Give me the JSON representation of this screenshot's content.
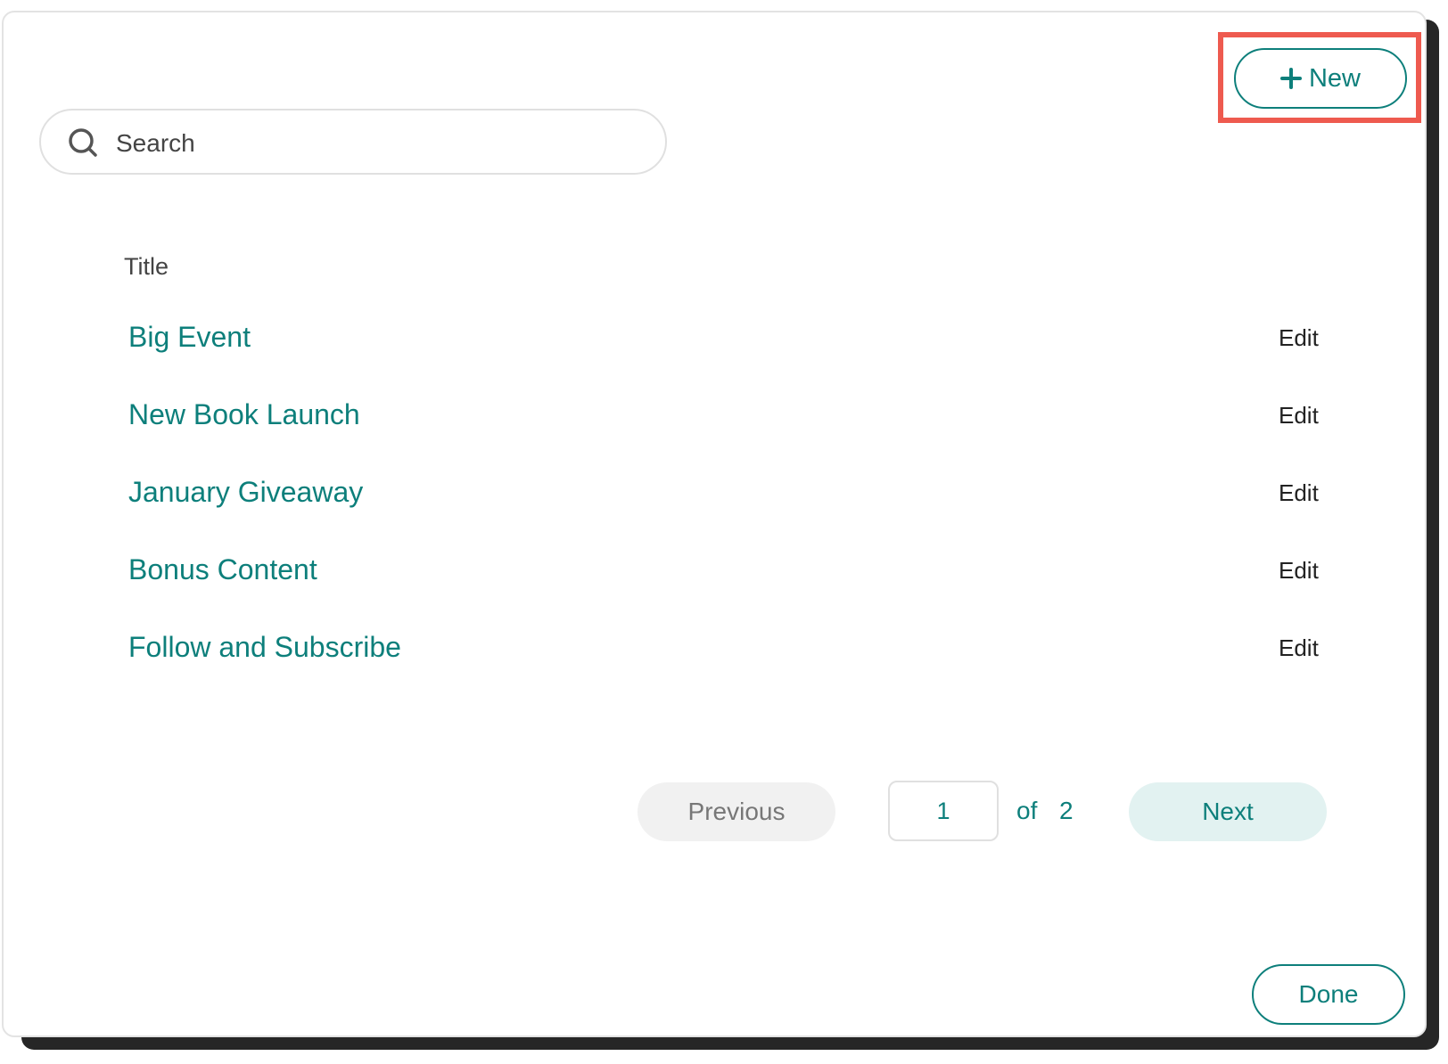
{
  "toolbar": {
    "new_label": "New"
  },
  "search": {
    "placeholder": "Search",
    "value": ""
  },
  "table": {
    "column_title": "Title",
    "rows": [
      {
        "title": "Big Event",
        "action": "Edit"
      },
      {
        "title": "New Book Launch",
        "action": "Edit"
      },
      {
        "title": "January Giveaway",
        "action": "Edit"
      },
      {
        "title": "Bonus Content",
        "action": "Edit"
      },
      {
        "title": "Follow and Subscribe",
        "action": "Edit"
      }
    ]
  },
  "pagination": {
    "previous_label": "Previous",
    "current_page": "1",
    "of_label": "of",
    "total_pages": "2",
    "next_label": "Next"
  },
  "footer": {
    "done_label": "Done"
  },
  "colors": {
    "accent": "#0d7f7b",
    "highlight": "#ee5a4f"
  }
}
